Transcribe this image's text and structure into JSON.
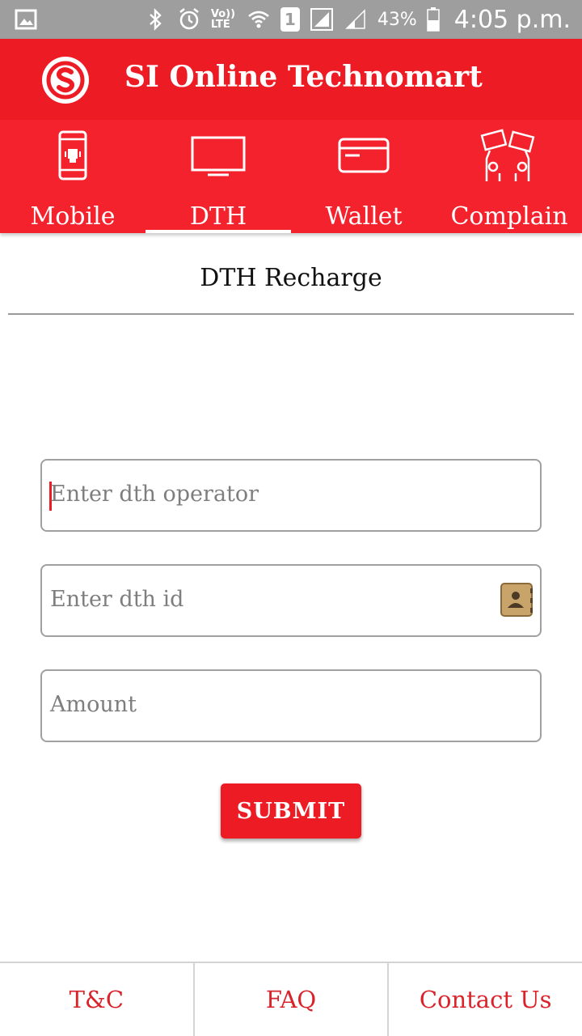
{
  "status_bar": {
    "battery_percent": "43%",
    "time": "4:05 p.m.",
    "network_label": "Vo)) LTE",
    "sim_slot": "1",
    "icons": [
      "gallery-icon",
      "bluetooth-icon",
      "alarm-icon",
      "volte-icon",
      "wifi-icon",
      "sim-icon",
      "signal-icon",
      "signal-weak-icon",
      "battery-icon"
    ]
  },
  "app_bar": {
    "title": "SI Online Technomart",
    "logo_icon": "si-logo-icon"
  },
  "tabs": [
    {
      "label": "Mobile",
      "icon": "mobile-phone-icon",
      "active": false
    },
    {
      "label": "DTH",
      "icon": "tv-icon",
      "active": true
    },
    {
      "label": "Wallet",
      "icon": "wallet-card-icon",
      "active": false
    },
    {
      "label": "Complain",
      "icon": "complain-icon",
      "active": false
    }
  ],
  "page": {
    "title": "DTH Recharge"
  },
  "form": {
    "operator_placeholder": "Enter dth operator",
    "dth_id_placeholder": "Enter dth id",
    "amount_placeholder": "Amount",
    "submit_label": "SUBMIT"
  },
  "footer": {
    "items": [
      "T&C",
      "FAQ",
      "Contact Us"
    ]
  },
  "colors": {
    "primary": "#ed1c24",
    "tab_background": "#f4222c",
    "status_bar": "#9e9e9e",
    "footer_text": "#d9232b"
  }
}
